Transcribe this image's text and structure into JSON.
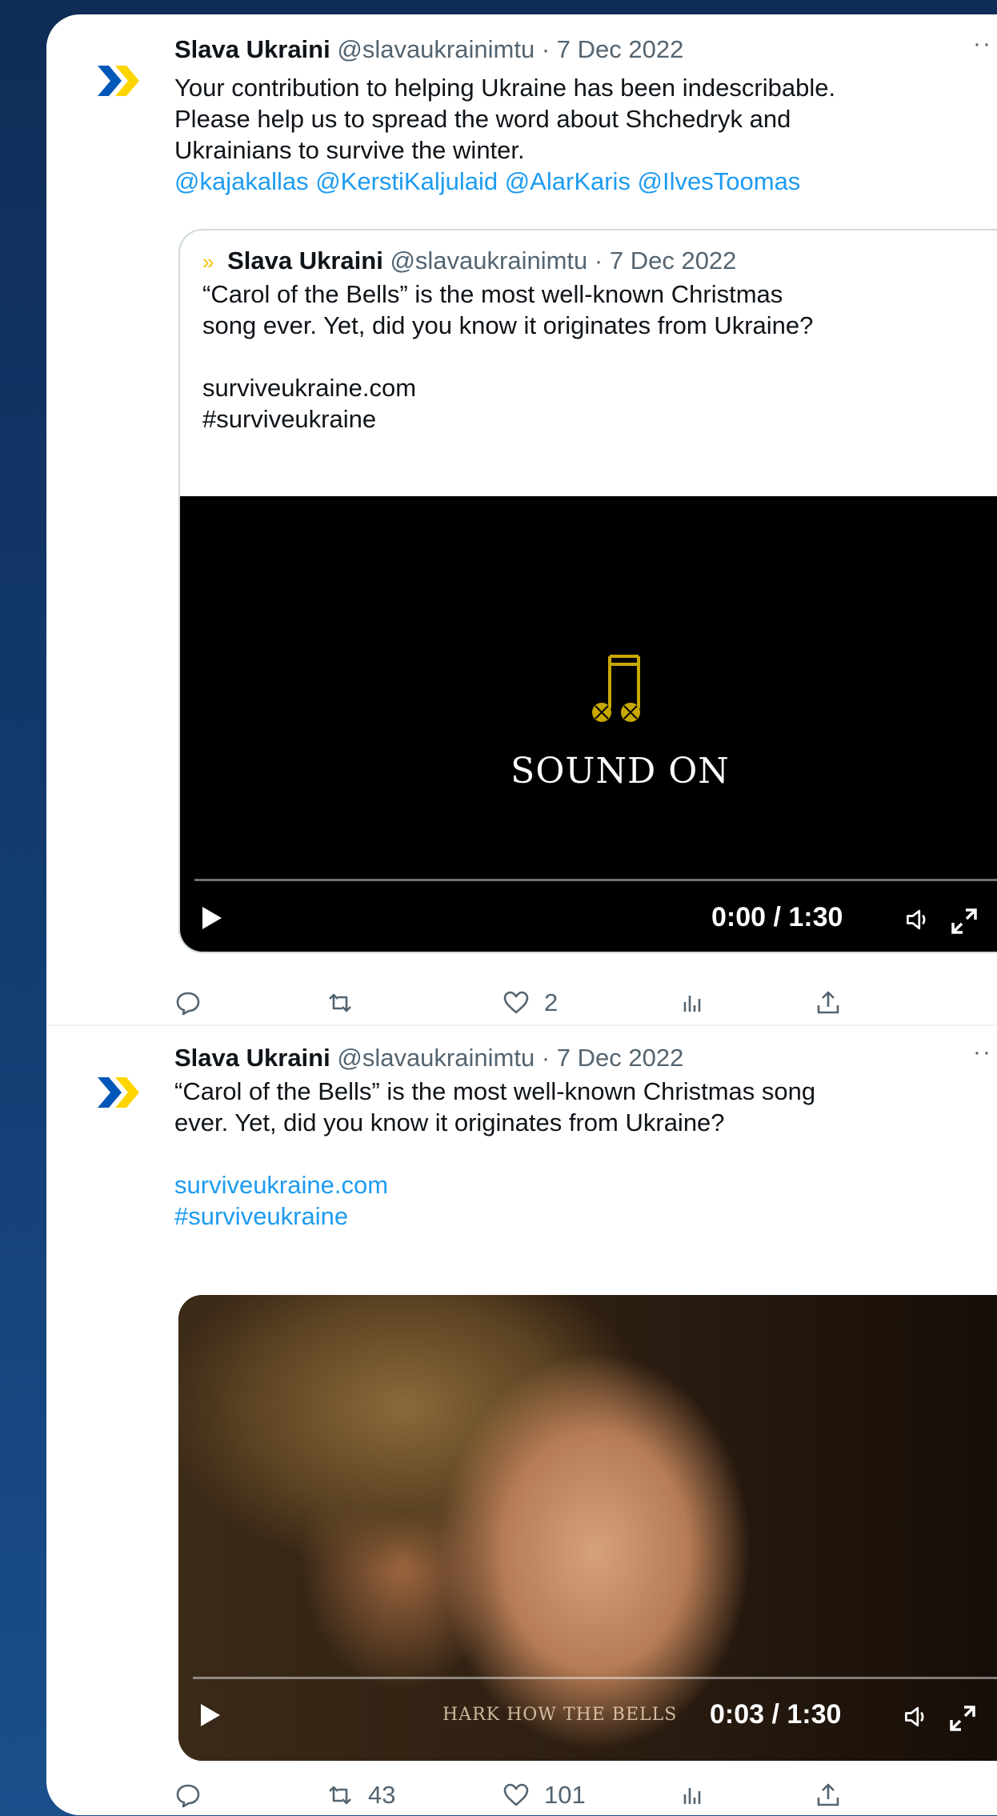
{
  "colors": {
    "accent": "#1d9bf0",
    "brand_blue": "#0057b7",
    "brand_yellow": "#ffd500"
  },
  "tweets": [
    {
      "name": "Slava Ukraini",
      "handle": "@slavaukrainimtu",
      "dot": "·",
      "date": "7 Dec 2022",
      "more": "··",
      "text_lines": [
        "Your contribution to helping Ukraine has been indescribable.",
        "Please help us to spread the word about Shchedryk and",
        "Ukrainians to survive the winter."
      ],
      "mentions": "@kajakallas @KerstiKaljulaid @AlarKaris @IlvesToomas",
      "quote": {
        "icon": "»",
        "name": "Slava Ukraini",
        "handle": "@slavaukrainimtu",
        "dot": "·",
        "date": "7 Dec 2022",
        "text_lines": [
          "“Carol of the Bells” is the most well-known Christmas",
          "song ever. Yet, did you know it originates from Ukraine?"
        ],
        "link": "surviveukraine.com",
        "hashtag": "#surviveukraine",
        "video": {
          "overlay_text": "SOUND ON",
          "time": "0:00 / 1:30",
          "progress": 0.0
        }
      },
      "actions": {
        "reply": "",
        "retweet": "",
        "like": "2",
        "views": "",
        "share": ""
      }
    },
    {
      "name": "Slava Ukraini",
      "handle": "@slavaukrainimtu",
      "dot": "·",
      "date": "7 Dec 2022",
      "more": "··",
      "text_lines": [
        "“Carol of the Bells” is the most well-known Christmas song",
        "ever. Yet, did you know it originates from Ukraine?"
      ],
      "link": "surviveukraine.com",
      "hashtag": "#surviveukraine",
      "video": {
        "caption": "HARK HOW THE BELLS",
        "time": "0:03 / 1:30",
        "progress": 0.033
      },
      "actions": {
        "reply": "",
        "retweet": "43",
        "like": "101",
        "views": "",
        "share": ""
      }
    }
  ]
}
